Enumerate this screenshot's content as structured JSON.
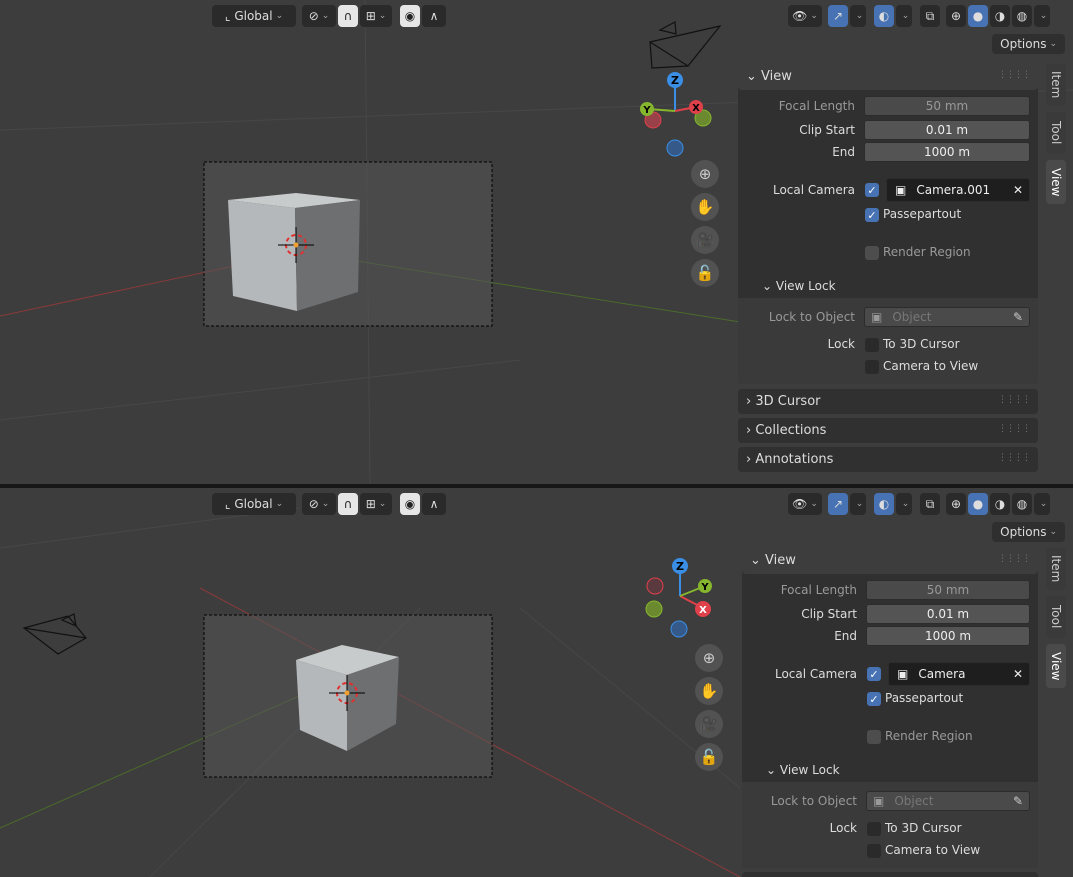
{
  "header": {
    "orientation_label": "Global",
    "shading_modes": [
      "wireframe-icon",
      "solid-icon",
      "material-icon",
      "rendered-icon"
    ]
  },
  "options_label": "Options",
  "tabs": [
    "Item",
    "Tool",
    "View"
  ],
  "views": [
    {
      "view_section": {
        "title": "View",
        "focal_length_label": "Focal Length",
        "focal_length_value": "50 mm",
        "clip_start_label": "Clip Start",
        "clip_start_value": "0.01 m",
        "end_label": "End",
        "end_value": "1000 m",
        "local_camera_label": "Local Camera",
        "local_camera_value": "Camera.001",
        "passepartout_label": "Passepartout",
        "render_region_label": "Render Region"
      },
      "view_lock": {
        "title": "View Lock",
        "lock_to_object_label": "Lock to Object",
        "lock_to_object_placeholder": "Object",
        "lock_label": "Lock",
        "to_3d_cursor_label": "To 3D Cursor",
        "camera_to_view_label": "Camera to View"
      },
      "collapsed_sections": [
        "3D Cursor",
        "Collections",
        "Annotations"
      ]
    },
    {
      "view_section": {
        "title": "View",
        "focal_length_label": "Focal Length",
        "focal_length_value": "50 mm",
        "clip_start_label": "Clip Start",
        "clip_start_value": "0.01 m",
        "end_label": "End",
        "end_value": "1000 m",
        "local_camera_label": "Local Camera",
        "local_camera_value": "Camera",
        "passepartout_label": "Passepartout",
        "render_region_label": "Render Region"
      },
      "view_lock": {
        "title": "View Lock",
        "lock_to_object_label": "Lock to Object",
        "lock_to_object_placeholder": "Object",
        "lock_label": "Lock",
        "to_3d_cursor_label": "To 3D Cursor",
        "camera_to_view_label": "Camera to View"
      },
      "collapsed_sections": []
    }
  ],
  "gizmo": {
    "x_label": "X",
    "y_label": "Y",
    "z_label": "Z"
  },
  "colors": {
    "accent": "#4772b3",
    "x_axis": "#e0404a",
    "y_axis": "#86b62e",
    "z_axis": "#3a8ee6"
  }
}
